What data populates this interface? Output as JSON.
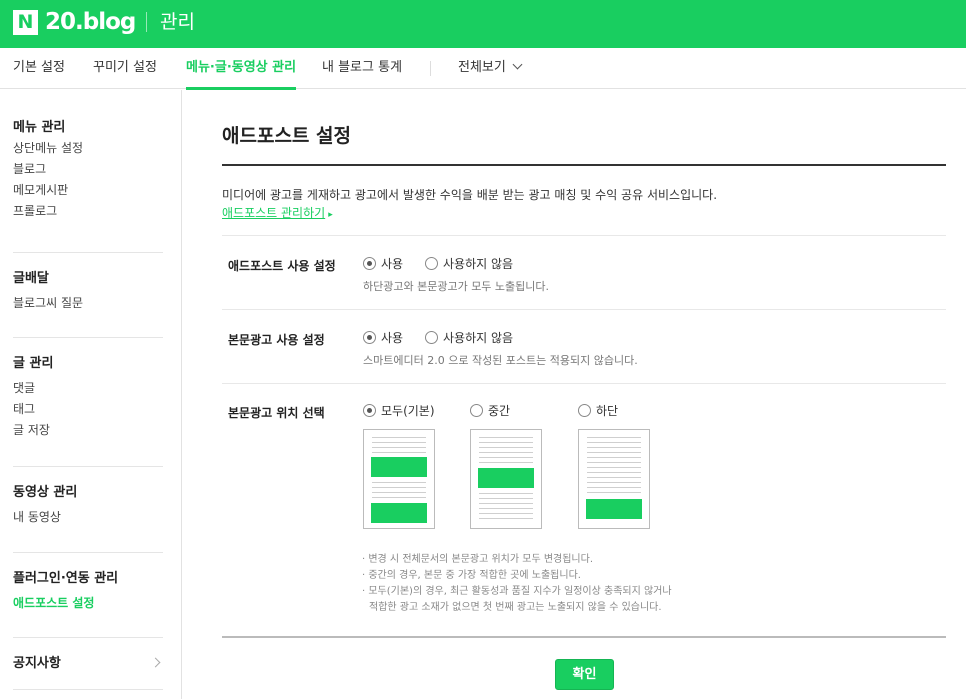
{
  "header": {
    "logo_letter": "N",
    "logo_text": "20.blog",
    "section": "관리",
    "brand_color": "#19ce60"
  },
  "nav": {
    "items": [
      "기본 설정",
      "꾸미기 설정",
      "메뉴·글·동영상 관리",
      "내 블로그 통계"
    ],
    "active": "메뉴·글·동영상 관리",
    "view_all": "전체보기"
  },
  "sidebar": {
    "groups": [
      {
        "title": "메뉴 관리",
        "items": [
          "상단메뉴 설정",
          "블로그",
          "메모게시판",
          "프롤로그"
        ]
      },
      {
        "title": "글배달",
        "items": [
          "블로그씨 질문"
        ]
      },
      {
        "title": "글 관리",
        "items": [
          "댓글",
          "태그",
          "글 저장"
        ]
      },
      {
        "title": "동영상 관리",
        "items": [
          "내 동영상"
        ]
      },
      {
        "title": "플러그인·연동 관리",
        "items": [
          "애드포스트 설정"
        ]
      },
      {
        "title": "공지사항",
        "items": []
      }
    ],
    "active_item": "애드포스트 설정"
  },
  "main": {
    "title": "애드포스트 설정",
    "description": "미디어에 광고를 게재하고 광고에서 발생한 수익을 배분 받는 광고 매칭 및 수익 공유 서비스입니다.",
    "manage_link": "애드포스트 관리하기",
    "use_setting": {
      "label": "애드포스트 사용 설정",
      "options": [
        "사용",
        "사용하지 않음"
      ],
      "selected": "사용",
      "hint": "하단광고와 본문광고가 모두 노출됩니다."
    },
    "body_ad_setting": {
      "label": "본문광고 사용 설정",
      "options": [
        "사용",
        "사용하지 않음"
      ],
      "selected": "사용",
      "hint": "스마트에디터 2.0 으로 작성된 포스트는 적용되지 않습니다."
    },
    "position_setting": {
      "label": "본문광고 위치 선택",
      "options": [
        "모두(기본)",
        "중간",
        "하단"
      ],
      "selected": "모두(기본)"
    },
    "notes": [
      "· 변경 시 전체문서의 본문광고 위치가 모두 변경됩니다.",
      "· 중간의 경우, 본문 중 가장 적합한 곳에 노출됩니다.",
      "· 모두(기본)의 경우, 최근 활동성과 품질 지수가 일정이상 충족되지 않거나",
      "  적합한 광고 소재가 없으면 첫 번째 광고는 노출되지 않을 수 있습니다."
    ],
    "confirm_label": "확인"
  }
}
